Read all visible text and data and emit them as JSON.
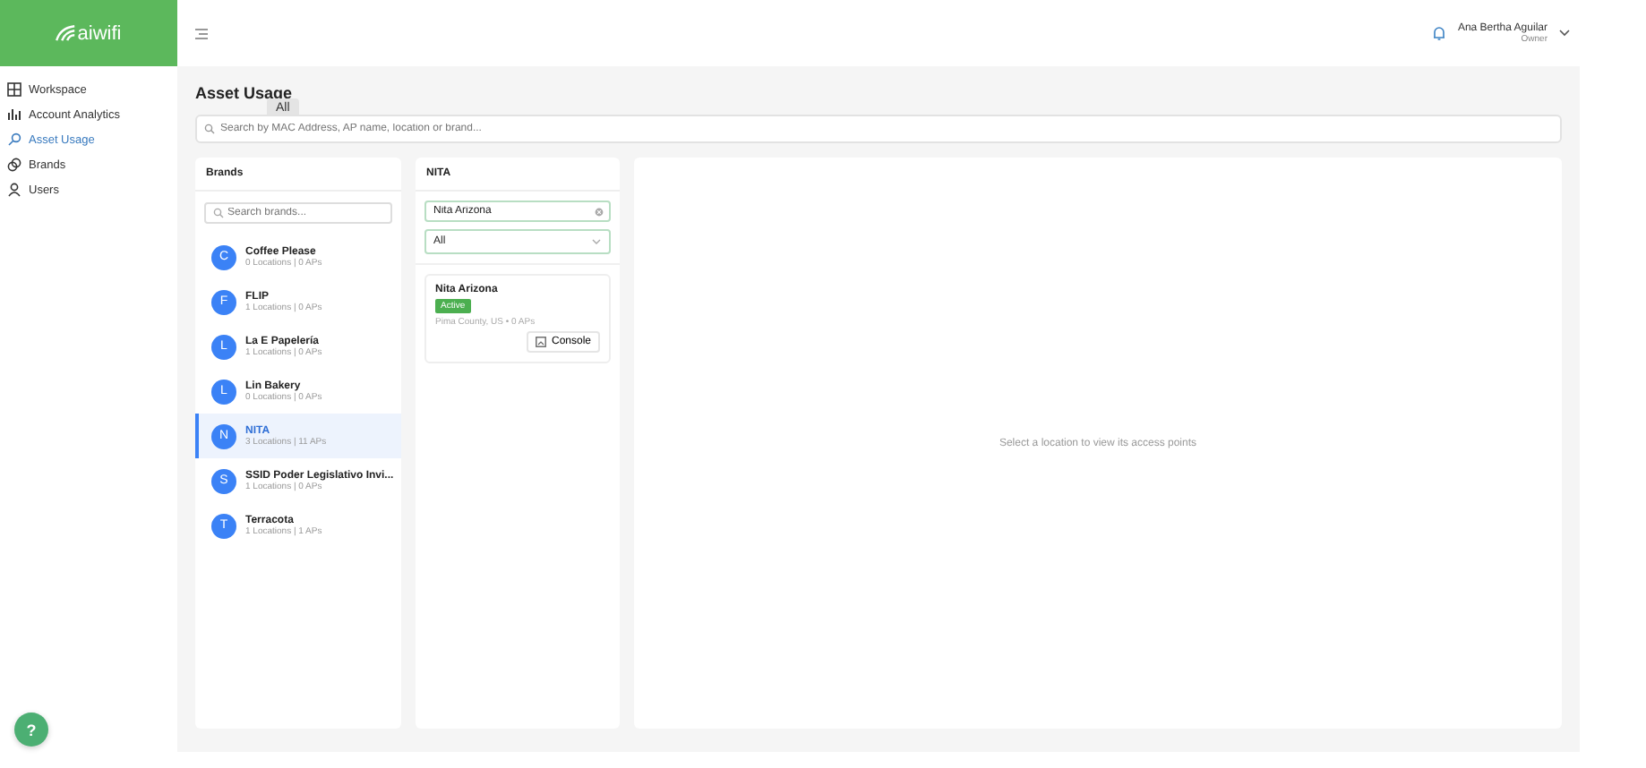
{
  "logo": "aiwifi",
  "nav": [
    {
      "label": "Workspace",
      "kind": "grid",
      "selected": false
    },
    {
      "label": "Account Analytics",
      "kind": "chart",
      "selected": false
    },
    {
      "label": "Asset Usage",
      "kind": "search",
      "selected": true
    },
    {
      "label": "Brands",
      "kind": "rings",
      "selected": false
    },
    {
      "label": "Users",
      "kind": "user",
      "selected": false
    }
  ],
  "header": {
    "user_name": "Ana Bertha Aguilar",
    "user_role": "Owner"
  },
  "page_title": "Asset Usage",
  "tooltip": "All",
  "search": {
    "placeholder": "Search by MAC Address, AP name, location or brand..."
  },
  "brands_panel": {
    "title": "Brands",
    "search_placeholder": "Search brands...",
    "brands": [
      {
        "initial": "C",
        "name": "Coffee Please",
        "meta": "0 Locations | 0 APs",
        "selected": false
      },
      {
        "initial": "F",
        "name": "FLIP",
        "meta": "1 Locations | 0 APs",
        "selected": false
      },
      {
        "initial": "L",
        "name": "La E Papelería",
        "meta": "1 Locations | 0 APs",
        "selected": false
      },
      {
        "initial": "L",
        "name": "Lin Bakery",
        "meta": "0 Locations | 0 APs",
        "selected": false
      },
      {
        "initial": "N",
        "name": "NITA",
        "meta": "3 Locations | 11 APs",
        "selected": true
      },
      {
        "initial": "S",
        "name": "SSID Poder Legislativo Invi...",
        "meta": "1 Locations | 0 APs",
        "selected": false
      },
      {
        "initial": "T",
        "name": "Terracota",
        "meta": "1 Locations | 1 APs",
        "selected": false
      }
    ]
  },
  "locations_panel": {
    "title": "NITA",
    "filter_value": "Nita Arizona",
    "status_filter": "All",
    "locations": [
      {
        "name": "Nita Arizona",
        "status": "Active",
        "meta": "Pima County, US • 0 APs",
        "button": "Console"
      }
    ]
  },
  "detail": {
    "empty_message": "Select a location to view its access points"
  },
  "help": "?"
}
